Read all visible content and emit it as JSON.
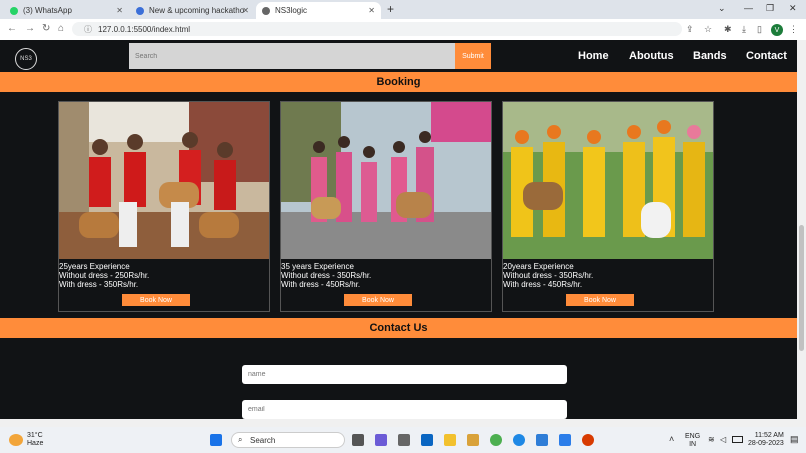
{
  "browser": {
    "tabs": [
      {
        "label": "(3) WhatsApp",
        "active": false
      },
      {
        "label": "New & upcoming hackathons · ...",
        "active": false
      },
      {
        "label": "NS3logic",
        "active": true
      }
    ],
    "url": "127.0.0.1:5500/index.html",
    "profile_initial": "V"
  },
  "site": {
    "logo_text": "NS3",
    "search_placeholder": "Search",
    "submit_label": "Submit",
    "nav": [
      "Home",
      "Aboutus",
      "Bands",
      "Contact"
    ],
    "booking_title": "Booking",
    "bands": [
      {
        "experience": "25years Experience",
        "without_dress": "Without dress - 250Rs/hr.",
        "with_dress": "With dress - 350Rs/hr.",
        "button": "Book Now"
      },
      {
        "experience": "35 years Experience",
        "without_dress": "Without dress - 350Rs/hr.",
        "with_dress": "With dress - 450Rs/hr.",
        "button": "Book Now"
      },
      {
        "experience": "20years Experience",
        "without_dress": "Without dress - 350Rs/hr.",
        "with_dress": "With dress - 450Rs/hr.",
        "button": "Book Now"
      }
    ],
    "contact_title": "Contact Us",
    "name_placeholder": "name",
    "email_placeholder": "email"
  },
  "taskbar": {
    "weather_temp": "31°C",
    "weather_desc": "Haze",
    "search_label": "Search",
    "lang_top": "ENG",
    "lang_bottom": "IN",
    "time": "11:52 AM",
    "date": "28-09-2023"
  },
  "colors": {
    "accent": "#ff8c3a",
    "background": "#111315"
  }
}
